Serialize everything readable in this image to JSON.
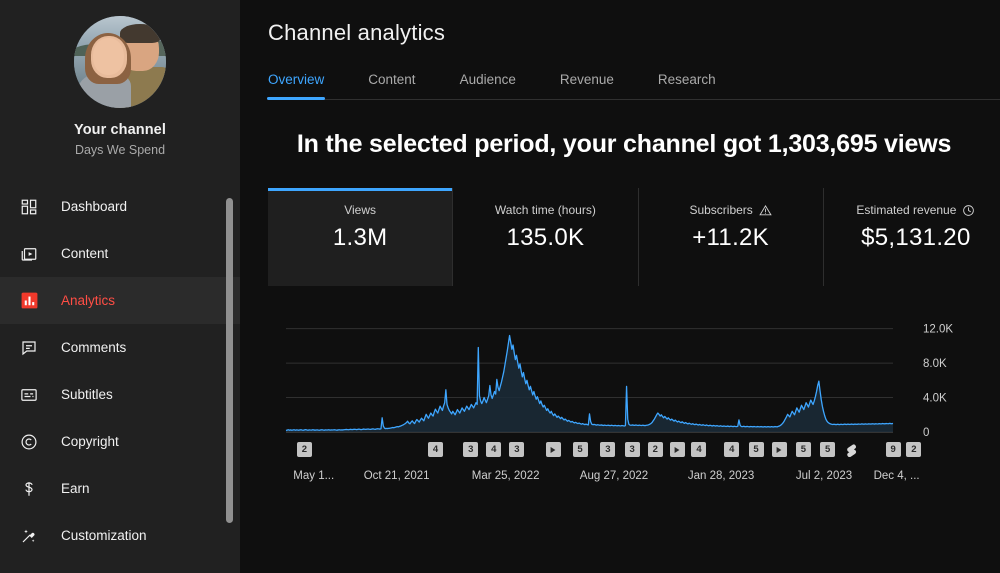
{
  "sidebar": {
    "channel": {
      "avatar_name": "channel-avatar",
      "title": "Your channel",
      "subtitle": "Days We Spend"
    },
    "items": [
      {
        "label": "Dashboard",
        "icon": "dashboard-icon",
        "active": false
      },
      {
        "label": "Content",
        "icon": "content-icon",
        "active": false
      },
      {
        "label": "Analytics",
        "icon": "analytics-icon",
        "active": true
      },
      {
        "label": "Comments",
        "icon": "comments-icon",
        "active": false
      },
      {
        "label": "Subtitles",
        "icon": "subtitles-icon",
        "active": false
      },
      {
        "label": "Copyright",
        "icon": "copyright-icon",
        "active": false
      },
      {
        "label": "Earn",
        "icon": "earn-icon",
        "active": false
      },
      {
        "label": "Customization",
        "icon": "customization-icon",
        "active": false
      }
    ],
    "accent_active_color": "#ff4e45",
    "background_color": "#212121"
  },
  "header": {
    "title": "Channel analytics",
    "tabs": [
      {
        "label": "Overview",
        "active": true
      },
      {
        "label": "Content",
        "active": false
      },
      {
        "label": "Audience",
        "active": false
      },
      {
        "label": "Revenue",
        "active": false
      },
      {
        "label": "Research",
        "active": false
      }
    ],
    "accent_color": "#3ea6ff"
  },
  "overview": {
    "headline": "In the selected period, your channel got 1,303,695 views",
    "cards": [
      {
        "label": "Views",
        "value": "1.3M",
        "icon": null,
        "active": true
      },
      {
        "label": "Watch time (hours)",
        "value": "135.0K",
        "icon": null,
        "active": false
      },
      {
        "label": "Subscribers",
        "value": "+11.2K",
        "icon": "warning-icon",
        "active": false
      },
      {
        "label": "Estimated revenue",
        "value": "$5,131.20",
        "icon": "clock-icon",
        "active": false
      }
    ]
  },
  "chart_data": {
    "type": "area",
    "title": "",
    "xlabel": "",
    "ylabel": "",
    "ylim": [
      0,
      13000
    ],
    "yticks": [
      0,
      4000,
      8000,
      12000
    ],
    "ytick_labels": [
      "0",
      "4.0K",
      "8.0K",
      "12.0K"
    ],
    "grid": true,
    "legend": null,
    "line_color": "#3ea6ff",
    "fill_color": "#1b2b38",
    "xtick_labels": [
      "May 1...",
      "Oct 21, 2021",
      "Mar 25, 2022",
      "Aug 27, 2022",
      "Jan 28, 2023",
      "Jul 2, 2023",
      "Dec 4, ..."
    ],
    "xtick_positions": [
      0.012,
      0.128,
      0.306,
      0.484,
      0.662,
      0.84,
      0.968
    ],
    "series": [
      {
        "name": "Views",
        "values": [
          180,
          220,
          260,
          210,
          240,
          200,
          230,
          260,
          210,
          250,
          230,
          200,
          240,
          260,
          220,
          200,
          240,
          270,
          230,
          210,
          250,
          230,
          220,
          260,
          240,
          210,
          230,
          250,
          220,
          200,
          240,
          260,
          230,
          210,
          250,
          230,
          240,
          260,
          220,
          240,
          230,
          250,
          260,
          230,
          210,
          240,
          260,
          230,
          250,
          240,
          260,
          280,
          300,
          280,
          260,
          290,
          310,
          280,
          300,
          320,
          300,
          280,
          310,
          330,
          300,
          280,
          310,
          340,
          320,
          300,
          330,
          350,
          320,
          300,
          340,
          360,
          330,
          310,
          350,
          380,
          360,
          340,
          380,
          1650,
          700,
          450,
          390,
          420,
          400,
          430,
          450,
          480,
          520,
          500,
          540,
          580,
          620,
          600,
          650,
          700,
          760,
          820,
          900,
          980,
          1100,
          1250,
          1050,
          950,
          1150,
          1300,
          1100,
          980,
          1250,
          1450,
          1300,
          1150,
          1400,
          1600,
          1450,
          1300,
          1700,
          2050,
          1800,
          1600,
          1900,
          2200,
          2000,
          1850,
          2300,
          2650,
          2400,
          2200,
          2600,
          3000,
          2750,
          2500,
          3000,
          3400,
          4900,
          3200,
          2800,
          2500,
          2300,
          2100,
          2400,
          2200,
          2000,
          2300,
          2600,
          2400,
          2200,
          2500,
          2800,
          2600,
          2400,
          2700,
          3000,
          2800,
          2600,
          2900,
          3200,
          3000,
          2800,
          3100,
          3400,
          3200,
          9800,
          4200,
          3600,
          3300,
          3600,
          4000,
          3700,
          3400,
          3800,
          4200,
          5400,
          4300,
          3900,
          4300,
          4700,
          4400,
          6100,
          5200,
          4800,
          5300,
          5800,
          6400,
          7000,
          7800,
          8600,
          9400,
          10300,
          11200,
          10400,
          9600,
          10100,
          9200,
          8400,
          8900,
          8100,
          7400,
          7900,
          7100,
          6400,
          6900,
          6200,
          5600,
          6000,
          5400,
          4900,
          5300,
          4800,
          4300,
          4700,
          4200,
          3800,
          4100,
          3700,
          3300,
          3600,
          3200,
          2900,
          3100,
          2800,
          2500,
          2700,
          2400,
          2200,
          2400,
          2100,
          1900,
          2100,
          1900,
          1700,
          1850,
          1700,
          1550,
          1700,
          1550,
          1400,
          1500,
          1380,
          1250,
          1350,
          1250,
          1150,
          1230,
          1130,
          1050,
          1120,
          1040,
          980,
          1040,
          970,
          910,
          970,
          910,
          860,
          910,
          860,
          820,
          2100,
          1200,
          900,
          850,
          880,
          840,
          800,
          840,
          810,
          780,
          820,
          790,
          760,
          800,
          770,
          750,
          790,
          760,
          740,
          780,
          750,
          730,
          770,
          740,
          720,
          760,
          730,
          710,
          750,
          730,
          700,
          740,
          5300,
          1500,
          900,
          800,
          780,
          820,
          790,
          770,
          810,
          780,
          760,
          800,
          770,
          750,
          790,
          760,
          740,
          780,
          800,
          830,
          900,
          980,
          1100,
          1300,
          1500,
          1750,
          2000,
          2200,
          2050,
          1850,
          2000,
          1800,
          1650,
          1800,
          1650,
          1500,
          1650,
          1500,
          1380,
          1500,
          1380,
          1260,
          1380,
          1260,
          1160,
          1260,
          1160,
          1080,
          1180,
          1080,
          1000,
          1100,
          1000,
          940,
          1020,
          950,
          890,
          960,
          900,
          850,
          920,
          860,
          810,
          880,
          820,
          780,
          840,
          790,
          750,
          810,
          760,
          720,
          780,
          740,
          700,
          760,
          720,
          690,
          740,
          700,
          670,
          720,
          680,
          650,
          700,
          670,
          640,
          690,
          660,
          630,
          680,
          650,
          620,
          670,
          640,
          620,
          660,
          1400,
          800,
          640,
          620,
          660,
          630,
          610,
          650,
          620,
          600,
          640,
          620,
          600,
          640,
          610,
          590,
          630,
          610,
          590,
          630,
          600,
          580,
          620,
          600,
          580,
          620,
          600,
          580,
          620,
          600,
          590,
          630,
          610,
          600,
          650,
          700,
          780,
          900,
          1050,
          1250,
          1500,
          1750,
          2050,
          1900,
          1750,
          2100,
          2400,
          2200,
          2000,
          2400,
          2800,
          2550,
          2300,
          2700,
          3100,
          2850,
          2600,
          3000,
          3400,
          3150,
          2900,
          3300,
          3700,
          3450,
          3200,
          3600,
          4100,
          4700,
          5400,
          5900,
          4800,
          3800,
          3000,
          2400,
          1900,
          1500,
          1250,
          1100,
          1000,
          940,
          900,
          870,
          900,
          880,
          860,
          900,
          880,
          860,
          900,
          880,
          870,
          910,
          890,
          870,
          910,
          890,
          880,
          920,
          900,
          880,
          920,
          900,
          890,
          930,
          910,
          900,
          940,
          920,
          900,
          940,
          920,
          910,
          950,
          930,
          920,
          960,
          940,
          920,
          960,
          940,
          930,
          970,
          950,
          940,
          980,
          960,
          950,
          990,
          970,
          960,
          1000,
          980,
          960,
          1000
        ]
      }
    ],
    "video_markers": [
      {
        "label": "2",
        "type": "count",
        "x": 0.018
      },
      {
        "label": "4",
        "type": "count",
        "x": 0.234
      },
      {
        "label": "3",
        "type": "count",
        "x": 0.292
      },
      {
        "label": "4",
        "type": "count",
        "x": 0.33
      },
      {
        "label": "3",
        "type": "count",
        "x": 0.368
      },
      {
        "label": "play",
        "type": "video",
        "x": 0.428
      },
      {
        "label": "5",
        "type": "count",
        "x": 0.472
      },
      {
        "label": "3",
        "type": "count",
        "x": 0.518
      },
      {
        "label": "3",
        "type": "count",
        "x": 0.558
      },
      {
        "label": "2",
        "type": "count",
        "x": 0.596
      },
      {
        "label": "play",
        "type": "video",
        "x": 0.632
      },
      {
        "label": "4",
        "type": "count",
        "x": 0.668
      },
      {
        "label": "4",
        "type": "count",
        "x": 0.722
      },
      {
        "label": "5",
        "type": "count",
        "x": 0.762
      },
      {
        "label": "play",
        "type": "video",
        "x": 0.8
      },
      {
        "label": "5",
        "type": "count",
        "x": 0.84
      },
      {
        "label": "5",
        "type": "count",
        "x": 0.88
      },
      {
        "label": "shorts",
        "type": "shorts",
        "x": 0.918
      },
      {
        "label": "9",
        "type": "count",
        "x": 0.988
      },
      {
        "label": "2",
        "type": "count",
        "x": 1.022
      }
    ]
  }
}
